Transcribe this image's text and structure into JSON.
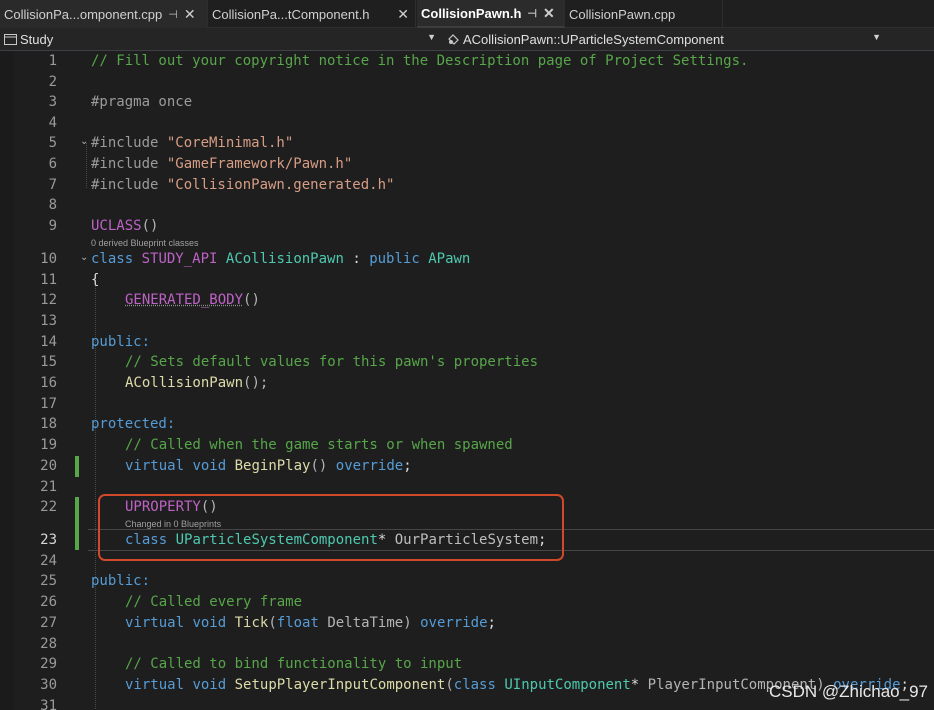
{
  "tabs": [
    {
      "label": "CollisionPa...omponent.cpp",
      "pin": "⊣",
      "close": "✕",
      "active": false
    },
    {
      "label": "CollisionPa...tComponent.h",
      "pin": "",
      "close": "✕",
      "active": false
    },
    {
      "label": "CollisionPawn.h",
      "pin": "⊣",
      "close": "✕",
      "active": true
    },
    {
      "label": "CollisionPawn.cpp",
      "pin": "",
      "close": "",
      "active": false
    }
  ],
  "nav": {
    "project": "Study",
    "scope": "ACollisionPawn::UParticleSystemComponent"
  },
  "code_lens": {
    "line9": "0 derived Blueprint classes",
    "line22": "Changed in 0 Blueprints"
  },
  "lines": [
    {
      "n": "1",
      "text": "// Fill out your copyright notice in the Description page of Project Settings."
    },
    {
      "n": "2",
      "text": ""
    },
    {
      "n": "3",
      "text": "#pragma once"
    },
    {
      "n": "4",
      "text": ""
    },
    {
      "n": "5",
      "text": "#include \"CoreMinimal.h\""
    },
    {
      "n": "6",
      "text": "#include \"GameFramework/Pawn.h\""
    },
    {
      "n": "7",
      "text": "#include \"CollisionPawn.generated.h\""
    },
    {
      "n": "8",
      "text": ""
    },
    {
      "n": "9",
      "text": "UCLASS()"
    },
    {
      "n": "10",
      "text": "class STUDY_API ACollisionPawn : public APawn"
    },
    {
      "n": "11",
      "text": "{"
    },
    {
      "n": "12",
      "text": "GENERATED_BODY()"
    },
    {
      "n": "13",
      "text": ""
    },
    {
      "n": "14",
      "text": "public:"
    },
    {
      "n": "15",
      "text": "// Sets default values for this pawn's properties"
    },
    {
      "n": "16",
      "text": "ACollisionPawn();"
    },
    {
      "n": "17",
      "text": ""
    },
    {
      "n": "18",
      "text": "protected:"
    },
    {
      "n": "19",
      "text": "// Called when the game starts or when spawned"
    },
    {
      "n": "20",
      "text": "virtual void BeginPlay() override;"
    },
    {
      "n": "21",
      "text": ""
    },
    {
      "n": "22",
      "text": "UPROPERTY()"
    },
    {
      "n": "23",
      "text": "class UParticleSystemComponent* OurParticleSystem;"
    },
    {
      "n": "24",
      "text": ""
    },
    {
      "n": "25",
      "text": "public:"
    },
    {
      "n": "26",
      "text": "// Called every frame"
    },
    {
      "n": "27",
      "text": "virtual void Tick(float DeltaTime) override;"
    },
    {
      "n": "28",
      "text": ""
    },
    {
      "n": "29",
      "text": "// Called to bind functionality to input"
    },
    {
      "n": "30",
      "text": "virtual void SetupPlayerInputComponent(class UInputComponent* PlayerInputComponent) override;"
    },
    {
      "n": "31",
      "text": ""
    }
  ],
  "current_line": "23",
  "watermark": "CSDN @Zhichao_97",
  "colors": {
    "comment": "#57a64a",
    "keyword": "#569cd6",
    "type": "#4ec9b0",
    "string": "#d69d85",
    "macro": "#bd63c5",
    "function": "#dcdcaa",
    "highlight_box": "#d0492b",
    "change_bar": "#57a64a"
  }
}
